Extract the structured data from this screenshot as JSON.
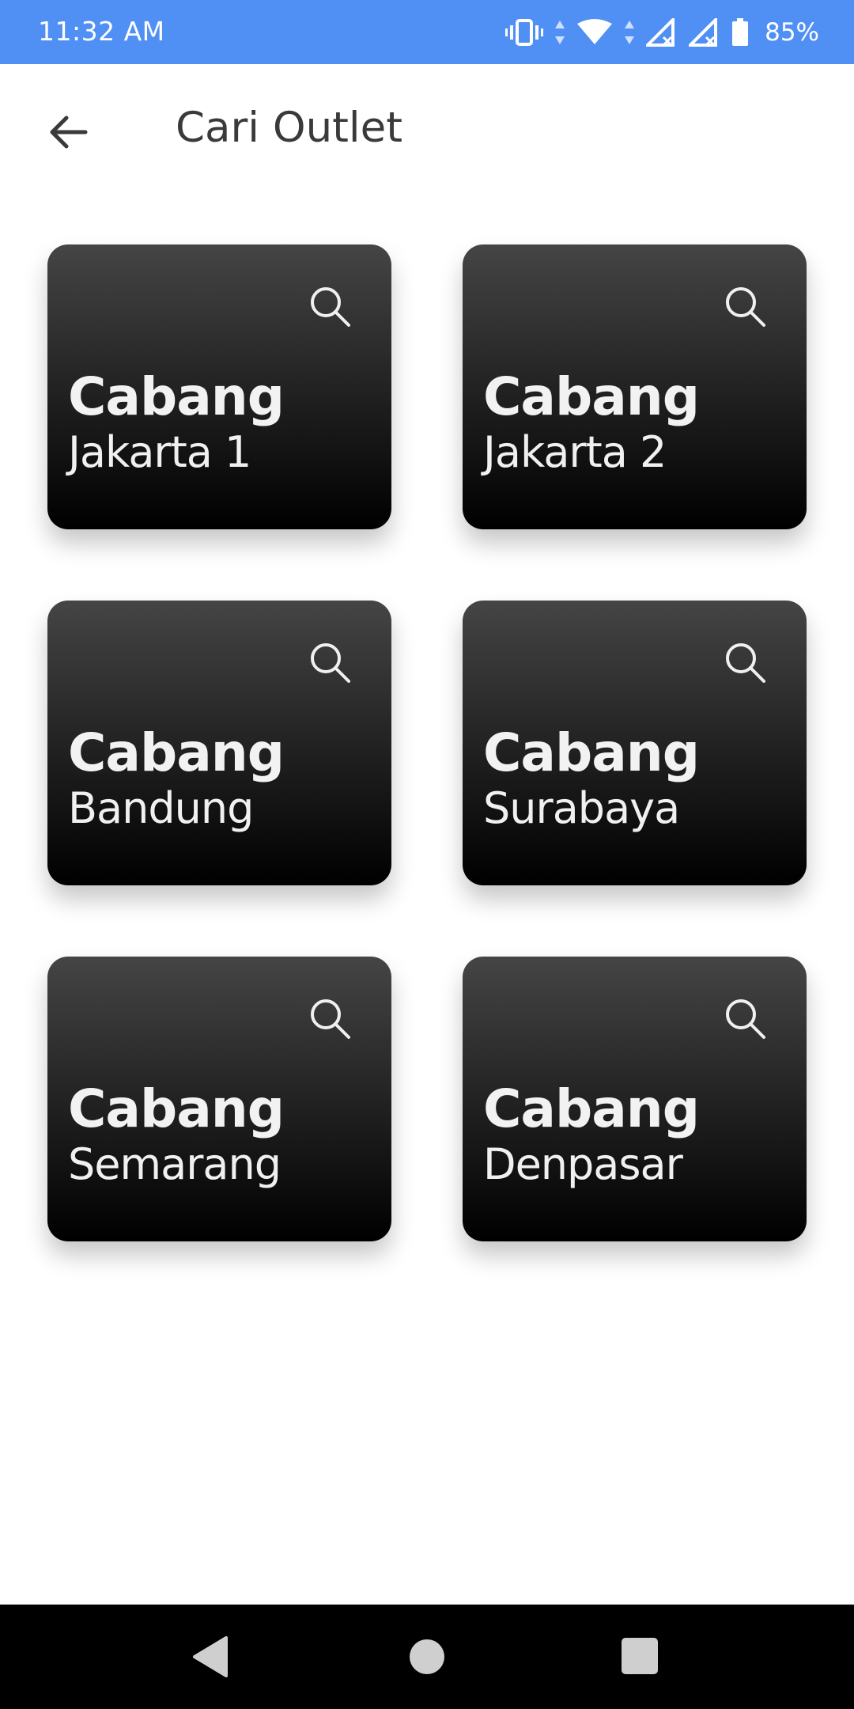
{
  "status_bar": {
    "time": "11:32 AM",
    "battery": "85%",
    "icons": [
      "vibrate-icon",
      "data-arrows-icon",
      "wifi-icon",
      "signal-icon",
      "signal-icon",
      "battery-icon"
    ]
  },
  "app_bar": {
    "back_icon": "arrow-back-icon",
    "title": "Cari Outlet"
  },
  "outlets": [
    {
      "title": "Cabang",
      "subtitle": "Jakarta 1",
      "icon": "search-icon"
    },
    {
      "title": "Cabang",
      "subtitle": "Jakarta 2",
      "icon": "search-icon"
    },
    {
      "title": "Cabang",
      "subtitle": "Bandung",
      "icon": "search-icon"
    },
    {
      "title": "Cabang",
      "subtitle": "Surabaya",
      "icon": "search-icon"
    },
    {
      "title": "Cabang",
      "subtitle": "Semarang",
      "icon": "search-icon"
    },
    {
      "title": "Cabang",
      "subtitle": "Denpasar",
      "icon": "search-icon"
    }
  ],
  "nav_bar": {
    "buttons": [
      "nav-back-icon",
      "nav-home-icon",
      "nav-recents-icon"
    ]
  },
  "colors": {
    "status_bar": "#5090f5",
    "card_top": "#454545",
    "card_bottom": "#000000",
    "title_text": "#3a3a3a"
  }
}
